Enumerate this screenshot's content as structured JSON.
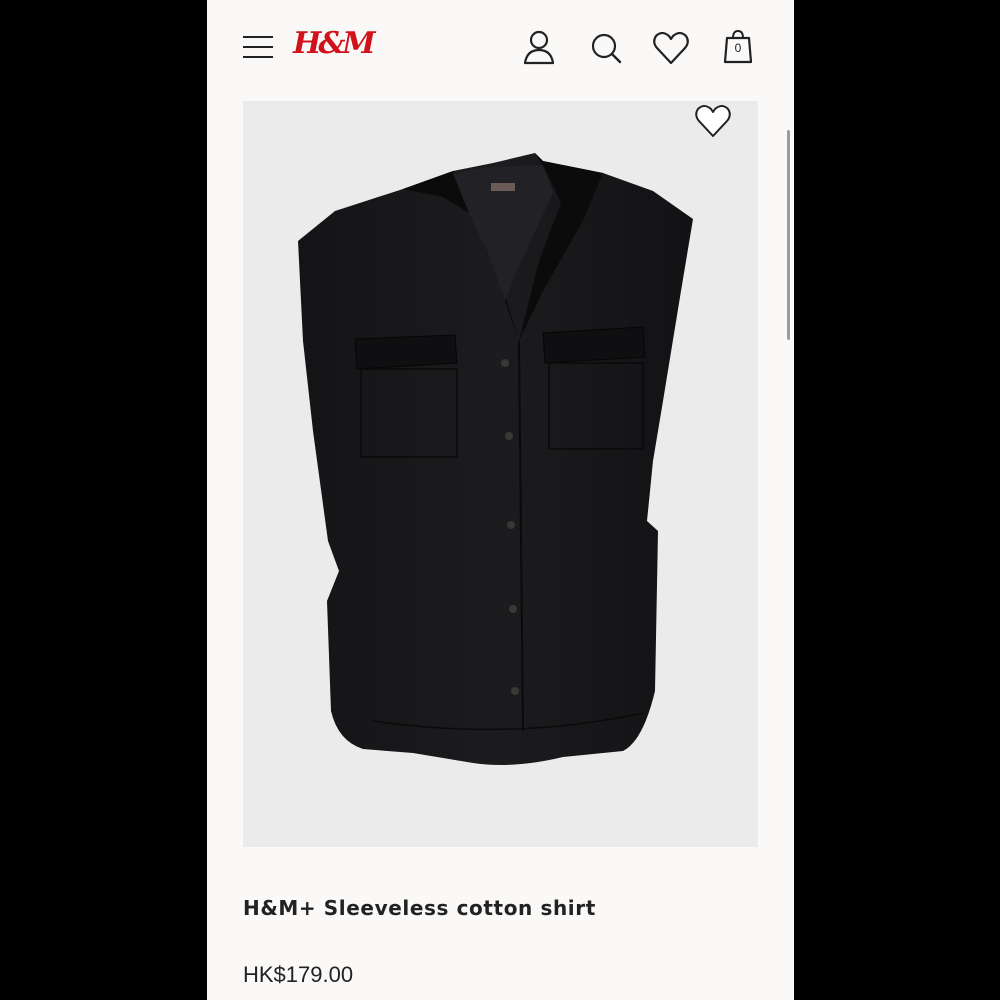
{
  "header": {
    "brand": "H&M",
    "brand_color": "#d1121b",
    "icons": [
      "menu-icon",
      "account-icon",
      "search-icon",
      "favorites-icon",
      "shopping-bag-icon"
    ],
    "bag_count": "0"
  },
  "product": {
    "title": "H&M+ Sleeveless cotton shirt",
    "price": "HK$179.00",
    "image_icon": "favorite-heart-icon"
  }
}
